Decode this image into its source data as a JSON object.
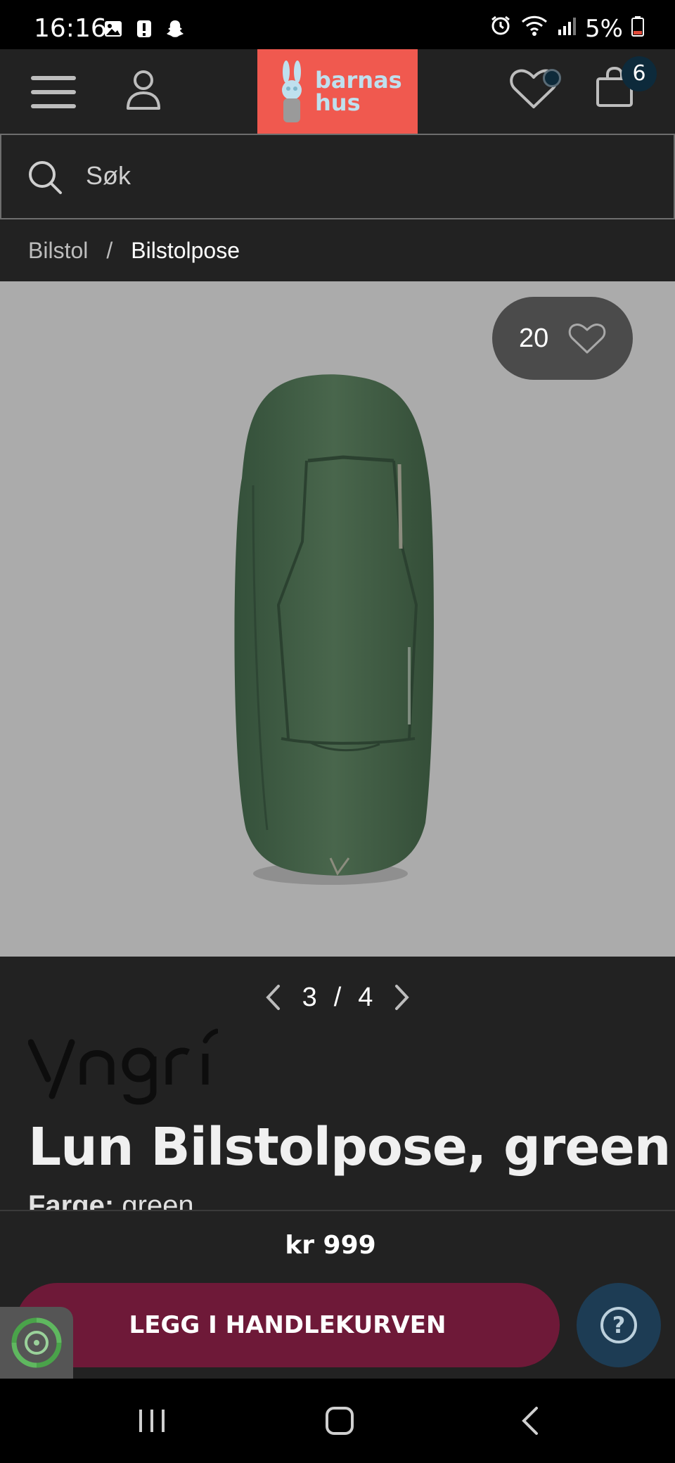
{
  "status_bar": {
    "time": "16:16",
    "battery": "5%",
    "icons_left": [
      "gallery-icon",
      "alert-icon",
      "snapchat-icon"
    ],
    "icons_right": [
      "alarm-icon",
      "wifi-icon",
      "signal-icon",
      "battery-icon"
    ]
  },
  "header": {
    "logo_line1": "barnas",
    "logo_line2": "hus",
    "cart_count": "6",
    "colors": {
      "header_bg": "#222222",
      "logo_bg": "#f0594f",
      "badge_bg": "#0d2a3b"
    }
  },
  "search": {
    "placeholder": "Søk"
  },
  "breadcrumb": {
    "items": [
      "Bilstol",
      "Bilstolpose"
    ],
    "separator": "/"
  },
  "gallery": {
    "favorite_count": "20",
    "current": "3",
    "total": "4",
    "separator": "/",
    "image_bg": "#ababab",
    "product_color": "#3f5a41"
  },
  "product": {
    "brand": "Yngri",
    "title": "Lun Bilstolpose, green",
    "color_label": "Farge:",
    "color_value": "green"
  },
  "purchase": {
    "price": "kr 999",
    "add_to_cart": "LEGG I HANDLEKURVEN",
    "help": "?",
    "colors": {
      "button_bg": "#6e1938",
      "help_bg": "#1d3c54"
    }
  },
  "navbar": {
    "icons": [
      "recent-apps-icon",
      "home-icon",
      "back-icon"
    ]
  }
}
